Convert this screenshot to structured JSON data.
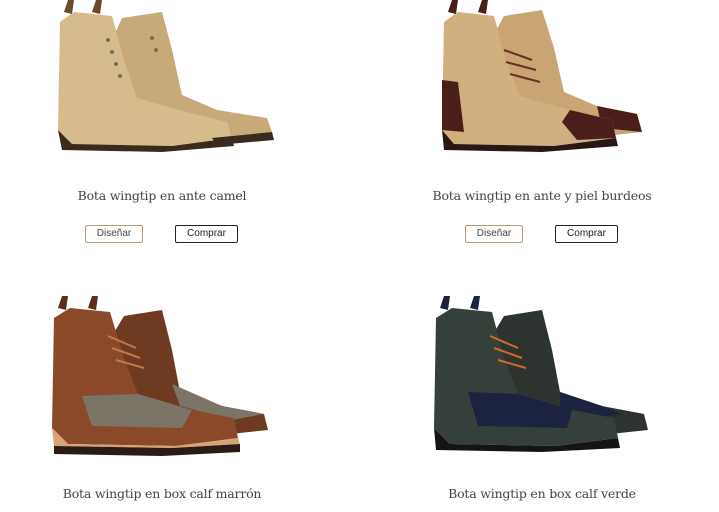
{
  "products": [
    {
      "title": "Bota wingtip en ante camel",
      "design_label": "Diseñar",
      "buy_label": "Comprar"
    },
    {
      "title": "Bota wingtip en ante y piel burdeos",
      "design_label": "Diseñar",
      "buy_label": "Comprar"
    },
    {
      "title": "Bota wingtip en box calf marrón"
    },
    {
      "title": "Bota wingtip en box calf verde"
    }
  ],
  "colors": {
    "camel": "#cfb184",
    "burgundy": "#4a1e1a",
    "brown": "#7a3f24",
    "green": "#2d332f",
    "navy": "#1c2340",
    "button_border_design": "#b89a7a",
    "button_border_buy": "#222222"
  },
  "icons": [
    "boot-image-camel",
    "boot-image-burgundy",
    "boot-image-brown",
    "boot-image-green"
  ]
}
